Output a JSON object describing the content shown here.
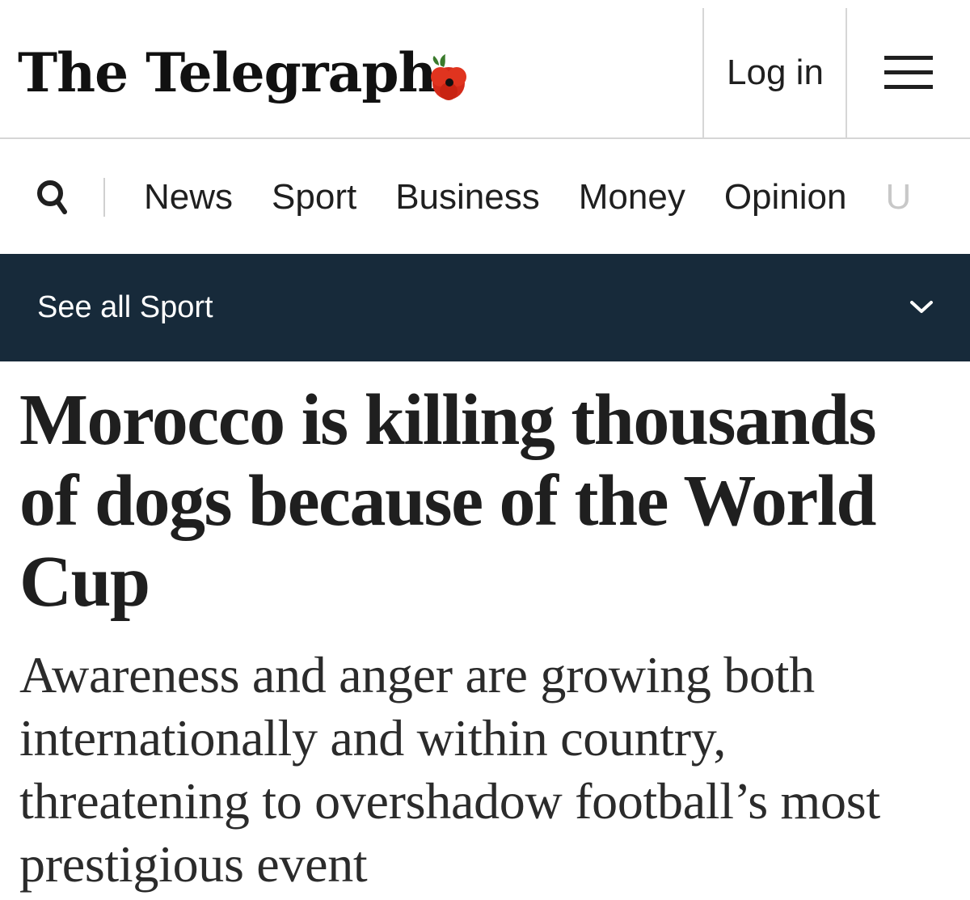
{
  "header": {
    "brand": "The Telegraph",
    "login_label": "Log in",
    "poppy_color": "#d42a1a",
    "menu_icon": "hamburger-menu-icon"
  },
  "nav": {
    "search_icon": "search-icon",
    "items": [
      "News",
      "Sport",
      "Business",
      "Money",
      "Opinion",
      "U"
    ]
  },
  "section_bar": {
    "label": "See all Sport",
    "background": "#172a3a",
    "icon": "chevron-down-icon"
  },
  "article": {
    "headline": "Morocco is killing thousands of dogs because of the World Cup",
    "standfirst": "Awareness and anger are growing both internationally and within country, threatening to overshadow football’s most prestigious event"
  }
}
